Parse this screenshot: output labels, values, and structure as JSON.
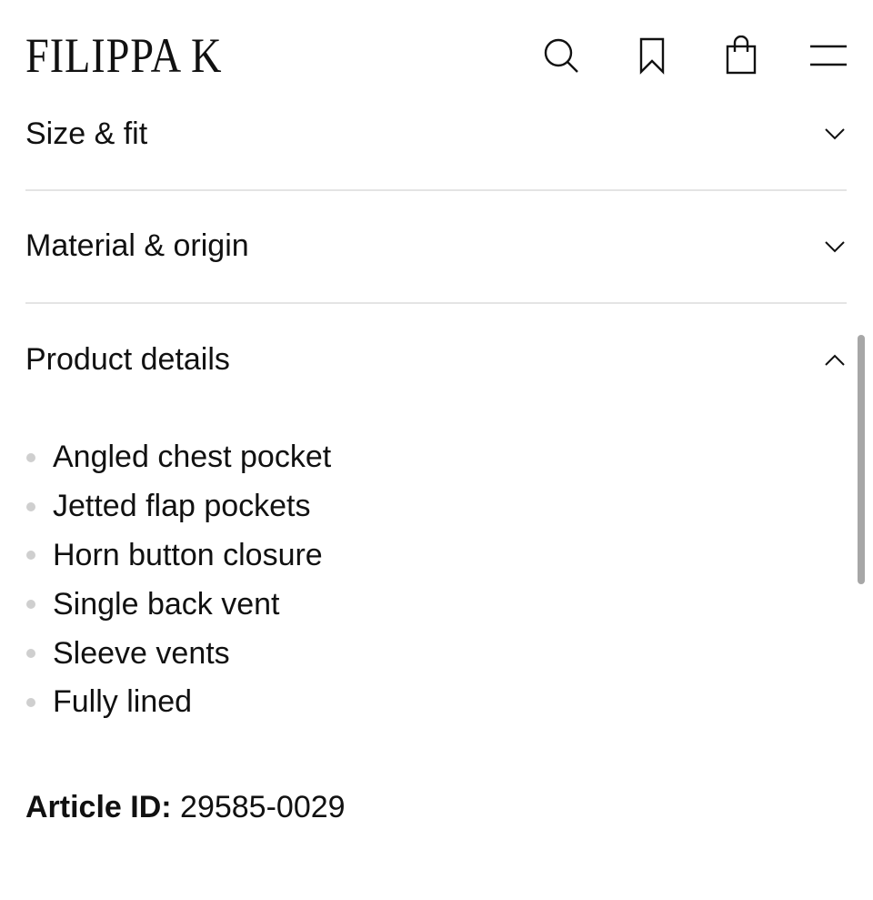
{
  "header": {
    "logo": "FILIPPA K",
    "icons": [
      "search-icon",
      "bookmark-icon",
      "shopping-bag-icon",
      "menu-icon"
    ]
  },
  "accordion": {
    "size_fit": {
      "label": "Size & fit",
      "expanded": false
    },
    "material_origin": {
      "label": "Material & origin",
      "expanded": false
    },
    "product_details": {
      "label": "Product details",
      "expanded": true,
      "items": [
        "Angled chest pocket",
        "Jetted flap pockets",
        "Horn button closure",
        "Single back vent",
        "Sleeve vents",
        "Fully lined"
      ]
    }
  },
  "article": {
    "label": "Article ID:",
    "value": "29585-0029"
  },
  "colors": {
    "text": "#111111",
    "divider": "#e4e4e4",
    "bullet": "#cfcfcf",
    "scrollbar": "#a7a7a7"
  }
}
